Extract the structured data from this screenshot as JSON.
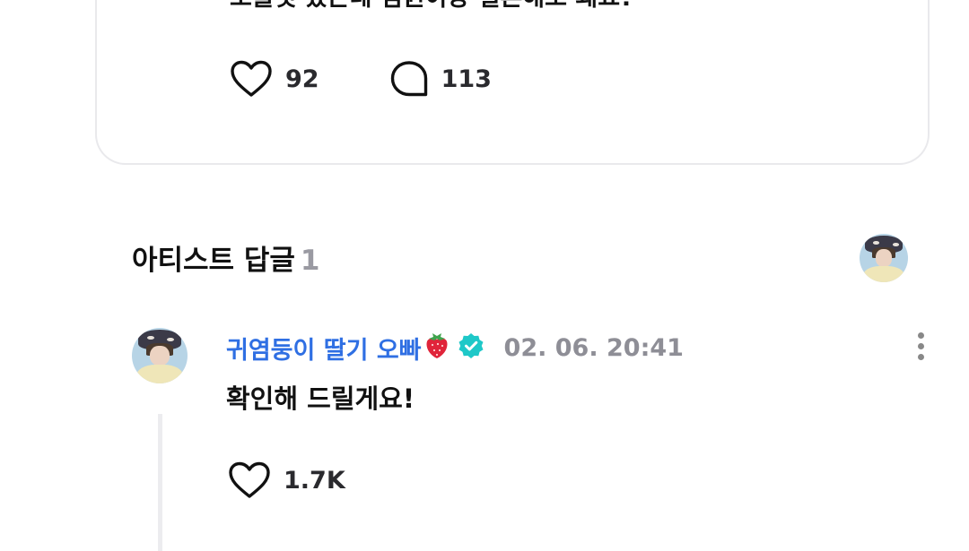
{
  "post": {
    "text": "초콜릿 샀는데 점원이랑 결혼해도 돼요?",
    "likes": "92",
    "comments": "113"
  },
  "artist_replies": {
    "title": "아티스트 답글",
    "count": "1"
  },
  "comment": {
    "author": "귀염둥이 딸기 오빠",
    "timestamp": "02. 06. 20:41",
    "text": "확인해 드릴게요!",
    "likes": "1.7K",
    "verified": true
  },
  "colors": {
    "accent": "#2f6fe3",
    "verified_badge": "#1ec8c8",
    "muted": "#8e8e96",
    "border": "#e9e9ec"
  },
  "icons": [
    "heart-icon",
    "comment-bubble-icon",
    "strawberry-icon",
    "verified-badge-icon",
    "more-vertical-icon"
  ]
}
